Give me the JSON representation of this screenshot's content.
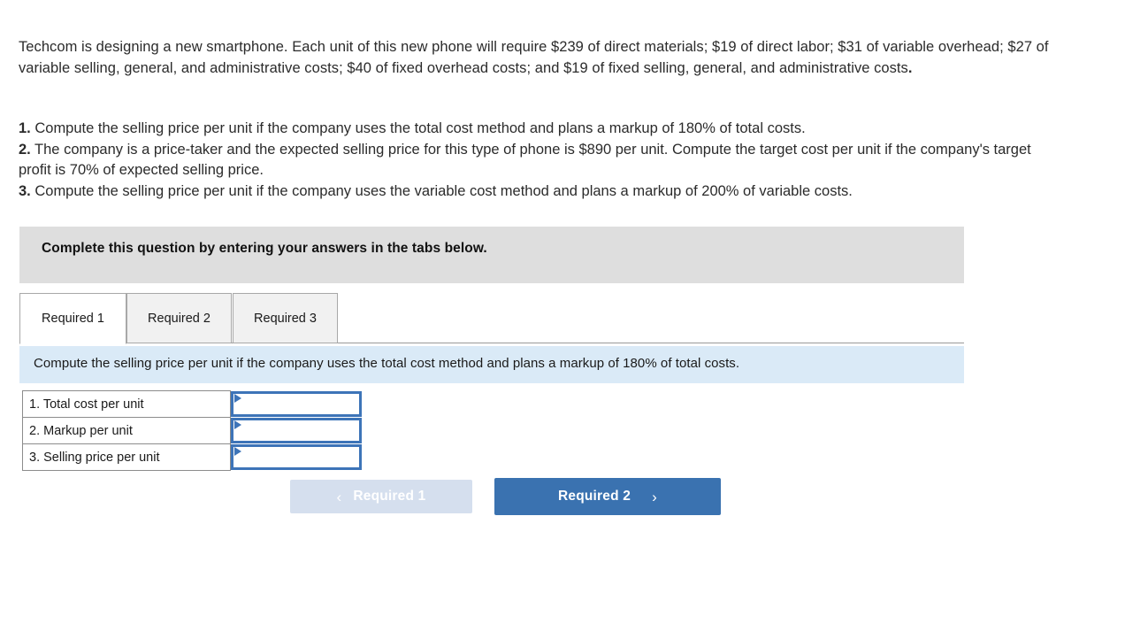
{
  "problem": {
    "intro_before_bold": "Techcom is designing a new smartphone. Each unit of this new phone will require $239 of direct materials; $19 of direct labor; $31 of variable overhead; $27 of variable selling, general, and administrative costs; $40 of fixed overhead costs; and $19 of fixed selling, general, and administrative costs",
    "intro_bold_tail": ".",
    "requirements": [
      {
        "number": "1.",
        "text": " Compute the selling price per unit if the company uses the total cost method and plans a markup of 180% of total costs."
      },
      {
        "number": "2.",
        "text": " The company is a price-taker and the expected selling price for this type of phone is $890 per unit. Compute the target cost per unit if the company's target profit is 70% of expected selling price."
      },
      {
        "number": "3.",
        "text": " Compute the selling price per unit if the company uses the variable cost method and plans a markup of 200% of variable costs."
      }
    ]
  },
  "instruction_banner": {
    "text": "Complete this question by entering your answers in the tabs below."
  },
  "tabs": [
    {
      "label": "Required 1",
      "active": true
    },
    {
      "label": "Required 2",
      "active": false
    },
    {
      "label": "Required 3",
      "active": false
    }
  ],
  "sub_instruction": {
    "text": "Compute the selling price per unit if the company uses the total cost method and plans a markup of 180% of total costs."
  },
  "answer_table": {
    "rows": [
      {
        "label": "1. Total cost per unit",
        "value": "",
        "placeholder": ""
      },
      {
        "label": "2. Markup per unit",
        "value": "",
        "placeholder": ""
      },
      {
        "label": "3. Selling price per unit",
        "value": "",
        "placeholder": ""
      }
    ]
  },
  "navigation": {
    "prev_label": "Required 1",
    "prev_icon": "chevron-left-icon",
    "prev_chevron": "‹",
    "next_label": "Required 2",
    "next_icon": "chevron-right-icon",
    "next_chevron": "›"
  },
  "colors": {
    "banner_gray": "#dedede",
    "sub_instruction_blue": "#daeaf7",
    "primary_blue": "#3a72b0",
    "disabled_blue": "#d5dfee",
    "input_border_blue": "#3d74b8",
    "tab_inactive": "#f1f1f1"
  }
}
